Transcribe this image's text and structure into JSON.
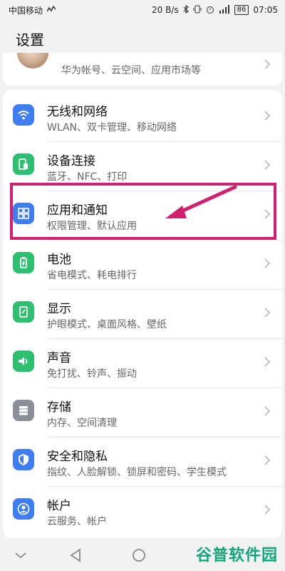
{
  "status": {
    "carrier": "中国移动",
    "speed": "20 B/s",
    "battery": "86",
    "time": "07:05"
  },
  "page": {
    "title": "设置"
  },
  "account": {
    "subtitle": "华为帐号、云空间、应用市场等"
  },
  "settings": [
    {
      "title": "无线和网络",
      "subtitle": "WLAN、双卡管理、移动网络",
      "icon": "wifi-icon",
      "color": "#3f7ef2"
    },
    {
      "title": "设备连接",
      "subtitle": "蓝牙、NFC、打印",
      "icon": "device-link-icon",
      "color": "#2fbf71"
    },
    {
      "title": "应用和通知",
      "subtitle": "权限管理、默认应用",
      "icon": "apps-grid-icon",
      "color": "#3f7ef2"
    },
    {
      "title": "电池",
      "subtitle": "省电模式、耗电排行",
      "icon": "battery-icon",
      "color": "#2fbf71"
    },
    {
      "title": "显示",
      "subtitle": "护眼模式、桌面风格、壁纸",
      "icon": "display-icon",
      "color": "#2fbf71"
    },
    {
      "title": "声音",
      "subtitle": "免打扰、铃声、振动",
      "icon": "sound-icon",
      "color": "#2fbf71"
    },
    {
      "title": "存储",
      "subtitle": "内存、空间清理",
      "icon": "storage-icon",
      "color": "#8a8f99"
    },
    {
      "title": "安全和隐私",
      "subtitle": "指纹、人脸解锁、锁屏和密码、学生模式",
      "icon": "shield-icon",
      "color": "#3f7ef2"
    },
    {
      "title": "帐户",
      "subtitle": "云服务、帐户",
      "icon": "account-icon",
      "color": "#3f7ef2"
    }
  ],
  "watermark": "谷普软件园",
  "accent": {
    "highlight": "#d1206f"
  }
}
